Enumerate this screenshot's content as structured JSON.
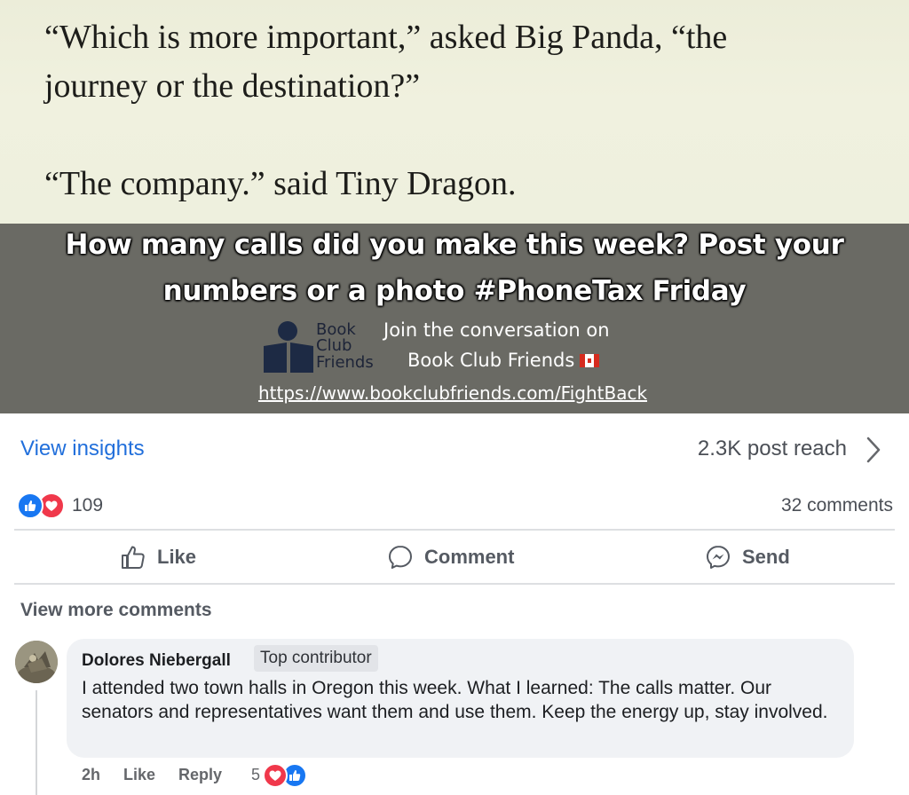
{
  "post_image": {
    "quote_line_1": "“Which is more important,” asked Big Panda, “the",
    "quote_line_2": "journey or the destination?”",
    "quote_line_3": "“The company.” said Tiny Dragon.",
    "headline_line_1": "How many calls did you make this week? Post your",
    "headline_line_2": "numbers or a photo #PhoneTax Friday",
    "logo_word_1": "Book",
    "logo_word_2": "Club",
    "logo_word_3": "Friends",
    "join_line_1": "Join the conversation on",
    "join_line_2": "Book Club Friends",
    "flag_icon": "canada-flag-icon",
    "url": "https://www.bookclubfriends.com/FightBack"
  },
  "insights": {
    "view_insights": "View insights",
    "reach": "2.3K post reach",
    "chevron_icon": "chevron-right-icon"
  },
  "reactions": {
    "icons": [
      "like-icon",
      "love-icon"
    ],
    "count": "109",
    "comments": "32 comments"
  },
  "actions": {
    "like": "Like",
    "comment": "Comment",
    "send": "Send"
  },
  "comments_section": {
    "view_more": "View more comments",
    "comment": {
      "author": "Dolores Niebergall",
      "badge": "Top contributor",
      "text": "I attended two town halls in Oregon this week. What I learned: The calls matter. Our senators and representatives want them and use them. Keep the energy up, stay involved.",
      "time": "2h",
      "like": "Like",
      "reply": "Reply",
      "reaction_count": "5",
      "reaction_icons": [
        "love-icon",
        "like-icon"
      ]
    }
  },
  "colors": {
    "link_blue": "#216fdb",
    "like_blue": "#1877f2",
    "love_red": "#f0384b",
    "banner_gray": "#6a6a64",
    "quote_paper": "#eeefdc"
  }
}
